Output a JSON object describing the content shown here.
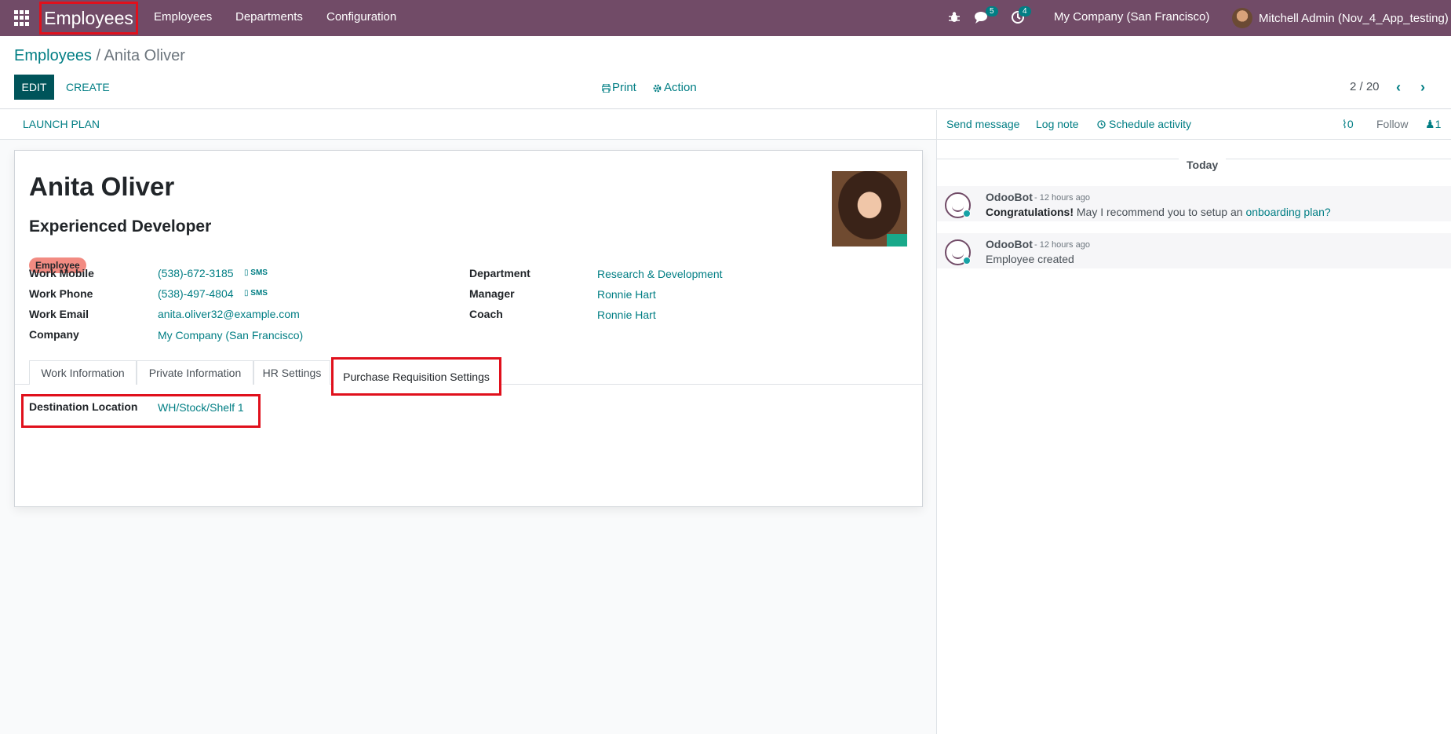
{
  "navbar": {
    "app_title": "Employees",
    "menu": [
      "Employees",
      "Departments",
      "Configuration"
    ],
    "messages_count": "5",
    "activities_count": "4",
    "company": "My Company (San Francisco)",
    "user": "Mitchell Admin (Nov_4_App_testing)"
  },
  "breadcrumb": {
    "parent": "Employees",
    "separator": "/",
    "current": "Anita Oliver"
  },
  "toolbar": {
    "edit": "EDIT",
    "create": "CREATE",
    "print": "Print",
    "action": "Action",
    "pager": "2 / 20"
  },
  "status": {
    "launch_plan": "LAUNCH PLAN"
  },
  "employee": {
    "name": "Anita Oliver",
    "job_title": "Experienced Developer",
    "tag": "Employee",
    "sms_label": "SMS",
    "left_fields": [
      {
        "label": "Work Mobile",
        "value": "(538)-672-3185"
      },
      {
        "label": "Work Phone",
        "value": "(538)-497-4804"
      },
      {
        "label": "Work Email",
        "value": "anita.oliver32@example.com"
      },
      {
        "label": "Company",
        "value": "My Company (San Francisco)"
      }
    ],
    "right_fields": [
      {
        "label": "Department",
        "value": "Research & Development"
      },
      {
        "label": "Manager",
        "value": "Ronnie Hart"
      },
      {
        "label": "Coach",
        "value": "Ronnie Hart"
      }
    ]
  },
  "tabs": [
    "Work Information",
    "Private Information",
    "HR Settings",
    "Purchase Requisition Settings"
  ],
  "active_tab": "Purchase Requisition Settings",
  "tab_content": {
    "label": "Destination Location",
    "value": "WH/Stock/Shelf 1"
  },
  "chatter": {
    "send_message": "Send message",
    "log_note": "Log note",
    "schedule_activity": "Schedule activity",
    "attachments": "0",
    "follow": "Follow",
    "followers": "1",
    "date_separator": "Today",
    "messages": [
      {
        "author": "OdooBot",
        "time": "- 12 hours ago",
        "bold": "Congratulations!",
        "text": "May I recommend you to setup an",
        "link": "onboarding plan?"
      },
      {
        "author": "OdooBot",
        "time": "- 12 hours ago",
        "text": "Employee created"
      }
    ]
  },
  "colors": {
    "navbar": "#714b67",
    "accent": "#017e84",
    "primary_button": "#00545a",
    "highlight": "#e0101c",
    "tag": "#f28b82"
  }
}
